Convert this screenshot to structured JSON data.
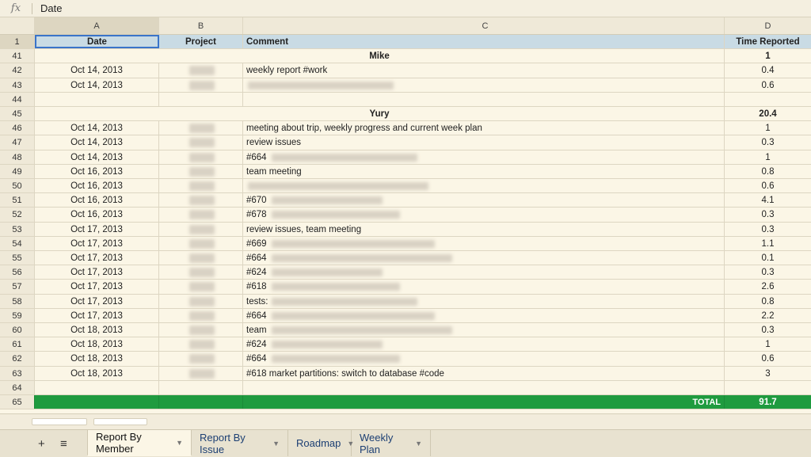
{
  "formula_bar": {
    "fx_icon": "fx",
    "value": "Date"
  },
  "columns": [
    "A",
    "B",
    "C",
    "D"
  ],
  "header": {
    "row": "1",
    "date": "Date",
    "project": "Project",
    "comment": "Comment",
    "time": "Time Reported"
  },
  "rows": [
    {
      "n": "41",
      "type": "group",
      "name": "Mike",
      "time": "1"
    },
    {
      "n": "42",
      "date": "Oct 14, 2013",
      "comment": "weekly report #work",
      "time": "0.4",
      "blurB": true
    },
    {
      "n": "43",
      "date": "Oct 14, 2013",
      "comment": "",
      "time": "0.6",
      "blurB": true,
      "blurC": true
    },
    {
      "n": "44"
    },
    {
      "n": "45",
      "type": "group",
      "name": "Yury",
      "time": "20.4"
    },
    {
      "n": "46",
      "date": "Oct 14, 2013",
      "comment": "meeting about trip, weekly progress and current week plan",
      "time": "1",
      "blurB": true
    },
    {
      "n": "47",
      "date": "Oct 14, 2013",
      "comment": "review issues",
      "time": "0.3",
      "blurB": true
    },
    {
      "n": "48",
      "date": "Oct 14, 2013",
      "comment": "#664",
      "time": "1",
      "blurB": true,
      "blurC": true
    },
    {
      "n": "49",
      "date": "Oct 16, 2013",
      "comment": "team meeting",
      "time": "0.8",
      "blurB": true
    },
    {
      "n": "50",
      "date": "Oct 16, 2013",
      "comment": "",
      "time": "0.6",
      "blurB": true,
      "blurC": true
    },
    {
      "n": "51",
      "date": "Oct 16, 2013",
      "comment": "#670",
      "time": "4.1",
      "blurB": true,
      "blurC": true
    },
    {
      "n": "52",
      "date": "Oct 16, 2013",
      "comment": "#678",
      "time": "0.3",
      "blurB": true,
      "blurC": true
    },
    {
      "n": "53",
      "date": "Oct 17, 2013",
      "comment": "review issues, team meeting",
      "time": "0.3",
      "blurB": true
    },
    {
      "n": "54",
      "date": "Oct 17, 2013",
      "comment": "#669",
      "time": "1.1",
      "blurB": true,
      "blurC": true
    },
    {
      "n": "55",
      "date": "Oct 17, 2013",
      "comment": "#664",
      "time": "0.1",
      "blurB": true,
      "blurC": true
    },
    {
      "n": "56",
      "date": "Oct 17, 2013",
      "comment": "#624",
      "time": "0.3",
      "blurB": true,
      "blurC": true
    },
    {
      "n": "57",
      "date": "Oct 17, 2013",
      "comment": "#618",
      "time": "2.6",
      "blurB": true,
      "blurC": true
    },
    {
      "n": "58",
      "date": "Oct 17, 2013",
      "comment": "tests:",
      "time": "0.8",
      "blurB": true,
      "blurC": true
    },
    {
      "n": "59",
      "date": "Oct 17, 2013",
      "comment": "#664",
      "time": "2.2",
      "blurB": true,
      "blurC": true
    },
    {
      "n": "60",
      "date": "Oct 18, 2013",
      "comment": "team",
      "time": "0.3",
      "blurB": true,
      "blurC": true
    },
    {
      "n": "61",
      "date": "Oct 18, 2013",
      "comment": "#624",
      "time": "1",
      "blurB": true,
      "blurC": true
    },
    {
      "n": "62",
      "date": "Oct 18, 2013",
      "comment": "#664",
      "time": "0.6",
      "blurB": true,
      "blurC": true
    },
    {
      "n": "63",
      "date": "Oct 18, 2013",
      "comment": "#618 market partitions: switch to database #code",
      "time": "3",
      "blurB": true
    },
    {
      "n": "64"
    },
    {
      "n": "65",
      "type": "total",
      "label": "TOTAL",
      "time": "91.7"
    }
  ],
  "tabs": {
    "add_icon": "+",
    "list_icon": "≡",
    "items": [
      {
        "label": "Report By Member",
        "active": true
      },
      {
        "label": "Report By Issue",
        "active": false
      },
      {
        "label": "Roadmap",
        "active": false
      },
      {
        "label": "Weekly Plan",
        "active": false
      }
    ],
    "dropdown_icon": "▼"
  },
  "colors": {
    "header_fill": "#c9dbe4",
    "total_fill": "#1f9b3f",
    "selection": "#3a74c9"
  }
}
